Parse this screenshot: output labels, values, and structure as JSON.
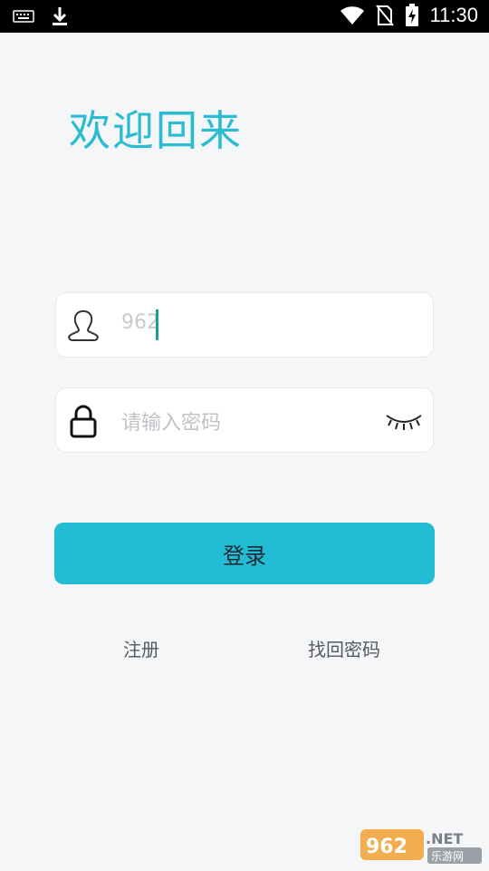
{
  "status_bar": {
    "time": "11:30",
    "icons": [
      "keyboard-icon",
      "download-icon",
      "wifi-icon",
      "no-sim-icon",
      "battery-charging-icon"
    ]
  },
  "login": {
    "welcome_title": "欢迎回来",
    "username_value": "962",
    "password_placeholder": "请输入密码",
    "login_button_label": "登录",
    "register_link": "注册",
    "forgot_password_link": "找回密码"
  },
  "watermark": {
    "brand": "962.NET",
    "subtitle": "乐游网"
  },
  "colors": {
    "accent": "#22bcd4",
    "title": "#29bcd3",
    "background": "#f5f6f8",
    "caret": "#1b9f8f"
  }
}
